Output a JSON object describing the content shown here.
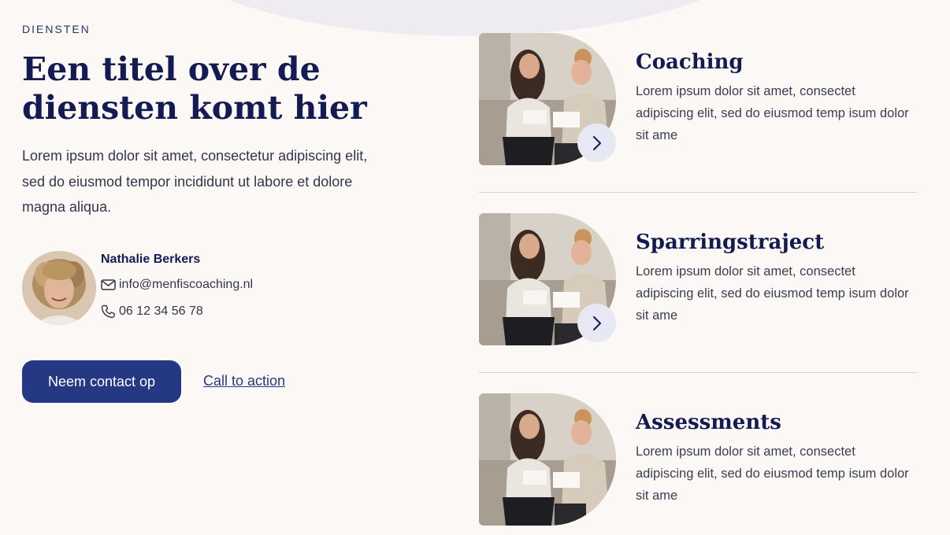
{
  "section": {
    "eyebrow": "DIENSTEN",
    "heading": "Een titel over de diensten komt hier",
    "intro": "Lorem ipsum dolor sit amet, consectetur adipiscing elit, sed do eiusmod tempor incididunt ut labore et dolore magna aliqua."
  },
  "contact": {
    "name": "Nathalie Berkers",
    "email": "info@menfiscoaching.nl",
    "phone": "06 12 34 56 78"
  },
  "actions": {
    "primary_label": "Neem contact op",
    "secondary_label": "Call to action"
  },
  "services": [
    {
      "title": "Coaching",
      "description": "Lorem ipsum dolor sit amet, consectet adipiscing elit, sed do eiusmod temp isum dolor sit ame"
    },
    {
      "title": "Sparringstraject",
      "description": "Lorem ipsum dolor sit amet, consectet adipiscing elit, sed do eiusmod temp isum dolor sit ame"
    },
    {
      "title": "Assessments",
      "description": "Lorem ipsum dolor sit amet, consectet adipiscing elit, sed do eiusmod temp isum dolor sit ame"
    }
  ],
  "icons": {
    "email": "envelope-icon",
    "phone": "phone-icon",
    "arrow": "chevron-right-icon"
  },
  "colors": {
    "background": "#fcf8f6",
    "navy": "#141b52",
    "button": "#253884",
    "arrow_bg": "#e7e8f3"
  }
}
